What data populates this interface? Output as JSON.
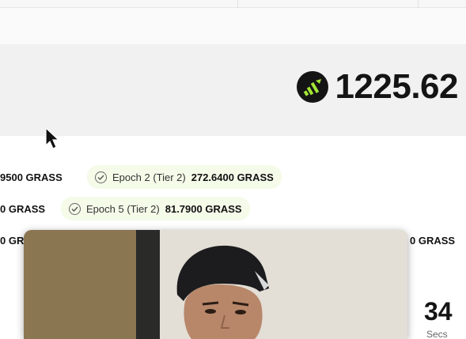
{
  "balance": {
    "value": "1225.62",
    "logo_icon": "grass-logo-icon",
    "logo_bg": "#141414",
    "logo_accent": "#a3e635"
  },
  "epochs": [
    {
      "label": "Epoch 2 (Tier 2)",
      "amount": "272.6400 GRASS"
    },
    {
      "label": "Epoch 5 (Tier 2)",
      "amount": "81.7900 GRASS"
    }
  ],
  "cut_amounts": {
    "row1_left": "9500 GRASS",
    "row2_left": "0 GRASS",
    "row3_left": "0 GR",
    "row3_right": "0 GRASS"
  },
  "counter": {
    "value": "34",
    "unit": "Secs"
  },
  "colors": {
    "pill_bg": "#f5fbe9",
    "card_bg": "#f1f1f1"
  }
}
